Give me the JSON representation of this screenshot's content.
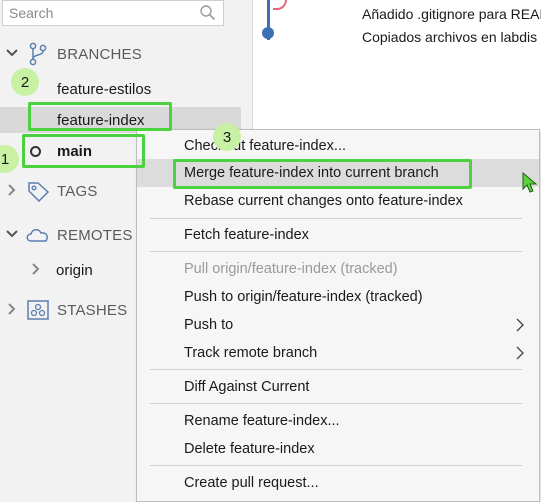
{
  "sidebar": {
    "search_placeholder": "Search",
    "sections": {
      "branches": "BRANCHES",
      "tags": "TAGS",
      "remotes": "REMOTES",
      "stashes": "STASHES"
    },
    "branches": [
      "feature-estilos",
      "feature-index",
      "main"
    ],
    "remotes": [
      "origin"
    ]
  },
  "commits": [
    "Añadido .gitignore para README",
    "Copiados archivos en labdis"
  ],
  "context_menu": {
    "items": [
      {
        "label": "Checkout feature-index...",
        "enabled": true
      },
      {
        "label": "Merge feature-index into current branch",
        "enabled": true,
        "hovered": true
      },
      {
        "label": "Rebase current changes onto feature-index",
        "enabled": true
      },
      {
        "label": "Fetch feature-index",
        "enabled": true
      },
      {
        "label": "Pull origin/feature-index (tracked)",
        "enabled": false
      },
      {
        "label": "Push to origin/feature-index (tracked)",
        "enabled": true
      },
      {
        "label": "Push to",
        "enabled": true,
        "submenu": true
      },
      {
        "label": "Track remote branch",
        "enabled": true,
        "submenu": true
      },
      {
        "label": "Diff Against Current",
        "enabled": true
      },
      {
        "label": "Rename feature-index...",
        "enabled": true
      },
      {
        "label": "Delete feature-index",
        "enabled": true
      },
      {
        "label": "Create pull request...",
        "enabled": true
      }
    ]
  },
  "annotations": {
    "step1": "1",
    "step2": "2",
    "step3": "3"
  },
  "colors": {
    "highlight_border": "#4cd13f",
    "badge_fill": "#c9f1a4",
    "graph_blue": "#3d6fb6",
    "graph_red": "#e46a7a"
  }
}
